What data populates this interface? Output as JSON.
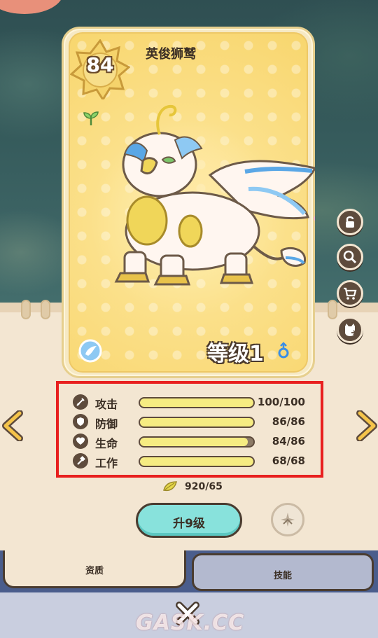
{
  "card": {
    "level": "84",
    "name": "英俊狮鹫",
    "level_text": "等级1"
  },
  "stats": [
    {
      "label": "攻击",
      "value": "100/100",
      "fill": 1.0,
      "icon": "sword-icon"
    },
    {
      "label": "防御",
      "value": "86/86",
      "fill": 1.0,
      "icon": "shield-icon"
    },
    {
      "label": "生命",
      "value": "84/86",
      "fill": 0.95,
      "icon": "heart-icon"
    },
    {
      "label": "工作",
      "value": "68/68",
      "fill": 1.0,
      "icon": "hammer-icon"
    }
  ],
  "cost": {
    "text": "920/65",
    "icon": "gold-leaf-icon"
  },
  "upgrade_button": {
    "label": "升9级"
  },
  "tabs": [
    {
      "label": "资质",
      "active": true
    },
    {
      "label": "技能",
      "active": false
    }
  ],
  "side_buttons": [
    "lock-icon",
    "magnify-icon",
    "cart-icon",
    "cat-share-icon"
  ],
  "watermark": "GASK.CC",
  "colors": {
    "bar_fill": "#f6ec82",
    "upgrade_button": "#88e2dc",
    "highlight_border": "#e8201f",
    "tab_bar": "#4a5d8c"
  }
}
